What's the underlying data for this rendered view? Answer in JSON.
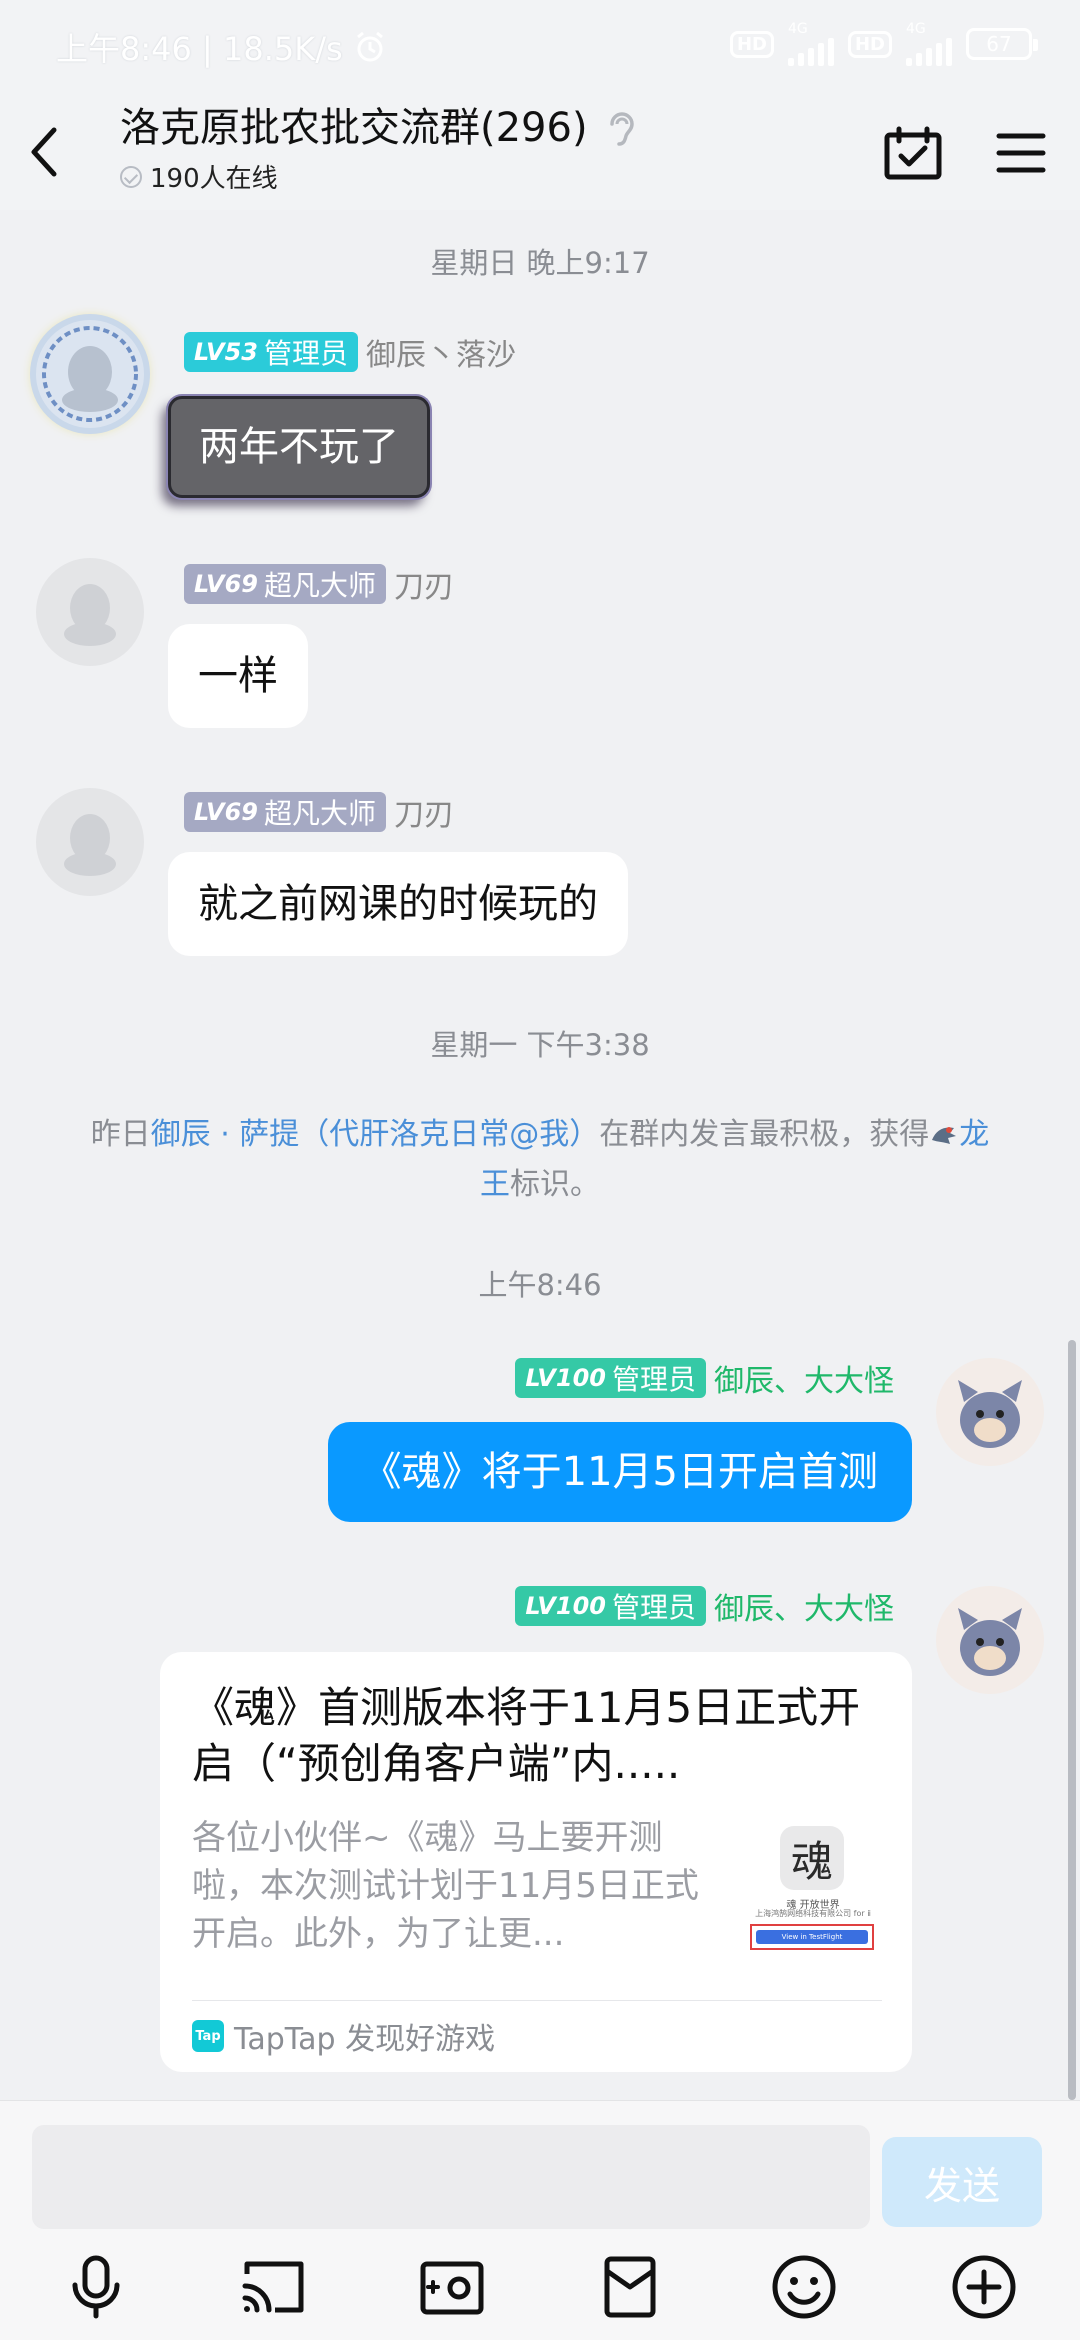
{
  "status_bar": {
    "left_text": "上午8:46 | 18.5K/s",
    "badge1": "HD",
    "net1": "4G",
    "badge2": "HD",
    "net2": "4G",
    "battery": "67"
  },
  "header": {
    "title": "洛克原批农批交流群(296)",
    "online": "190人在线"
  },
  "chat": {
    "timestamps": [
      "星期日 晚上9:17",
      "星期一 下午3:38",
      "上午8:46"
    ],
    "messages": [
      {
        "level": "LV53",
        "role": "管理员",
        "name": "御辰丶落沙",
        "text": "两年不玩了"
      },
      {
        "level": "LV69",
        "role": "超凡大师",
        "name": "刀刃",
        "text": "一样"
      },
      {
        "level": "LV69",
        "role": "超凡大师",
        "name": "刀刃",
        "text": "就之前网课的时候玩的"
      },
      {
        "level": "LV100",
        "role": "管理员",
        "name": "御辰、大大怪",
        "text": "《魂》将于11月5日开启首测"
      },
      {
        "level": "LV100",
        "role": "管理员",
        "name": "御辰、大大怪"
      }
    ],
    "system": {
      "prefix": "昨日",
      "user": "御辰 · 萨提（代肝洛克日常@我）",
      "middle": "在群内发言最积极，获得",
      "badge_line1": "龙",
      "badge_line2": "王",
      "suffix": "标识。"
    },
    "card": {
      "title": "《魂》首测版本将于11月5日正式开启（“预创角客户端”内.....",
      "desc": "各位小伙伴~《魂》马上要开测啦，本次测试计划于11月5日正式开启。此外，为了让更...",
      "thumb_char": "魂",
      "thumb_line1": "魂 开放世界",
      "thumb_line2": "上海鸿鹄网络科技有限公司 for ⅱ",
      "thumb_button": "View in TestFlight",
      "source_logo": "Tap",
      "source": "TapTap 发现好游戏"
    }
  },
  "input": {
    "placeholder": "",
    "send_label": "发送"
  }
}
